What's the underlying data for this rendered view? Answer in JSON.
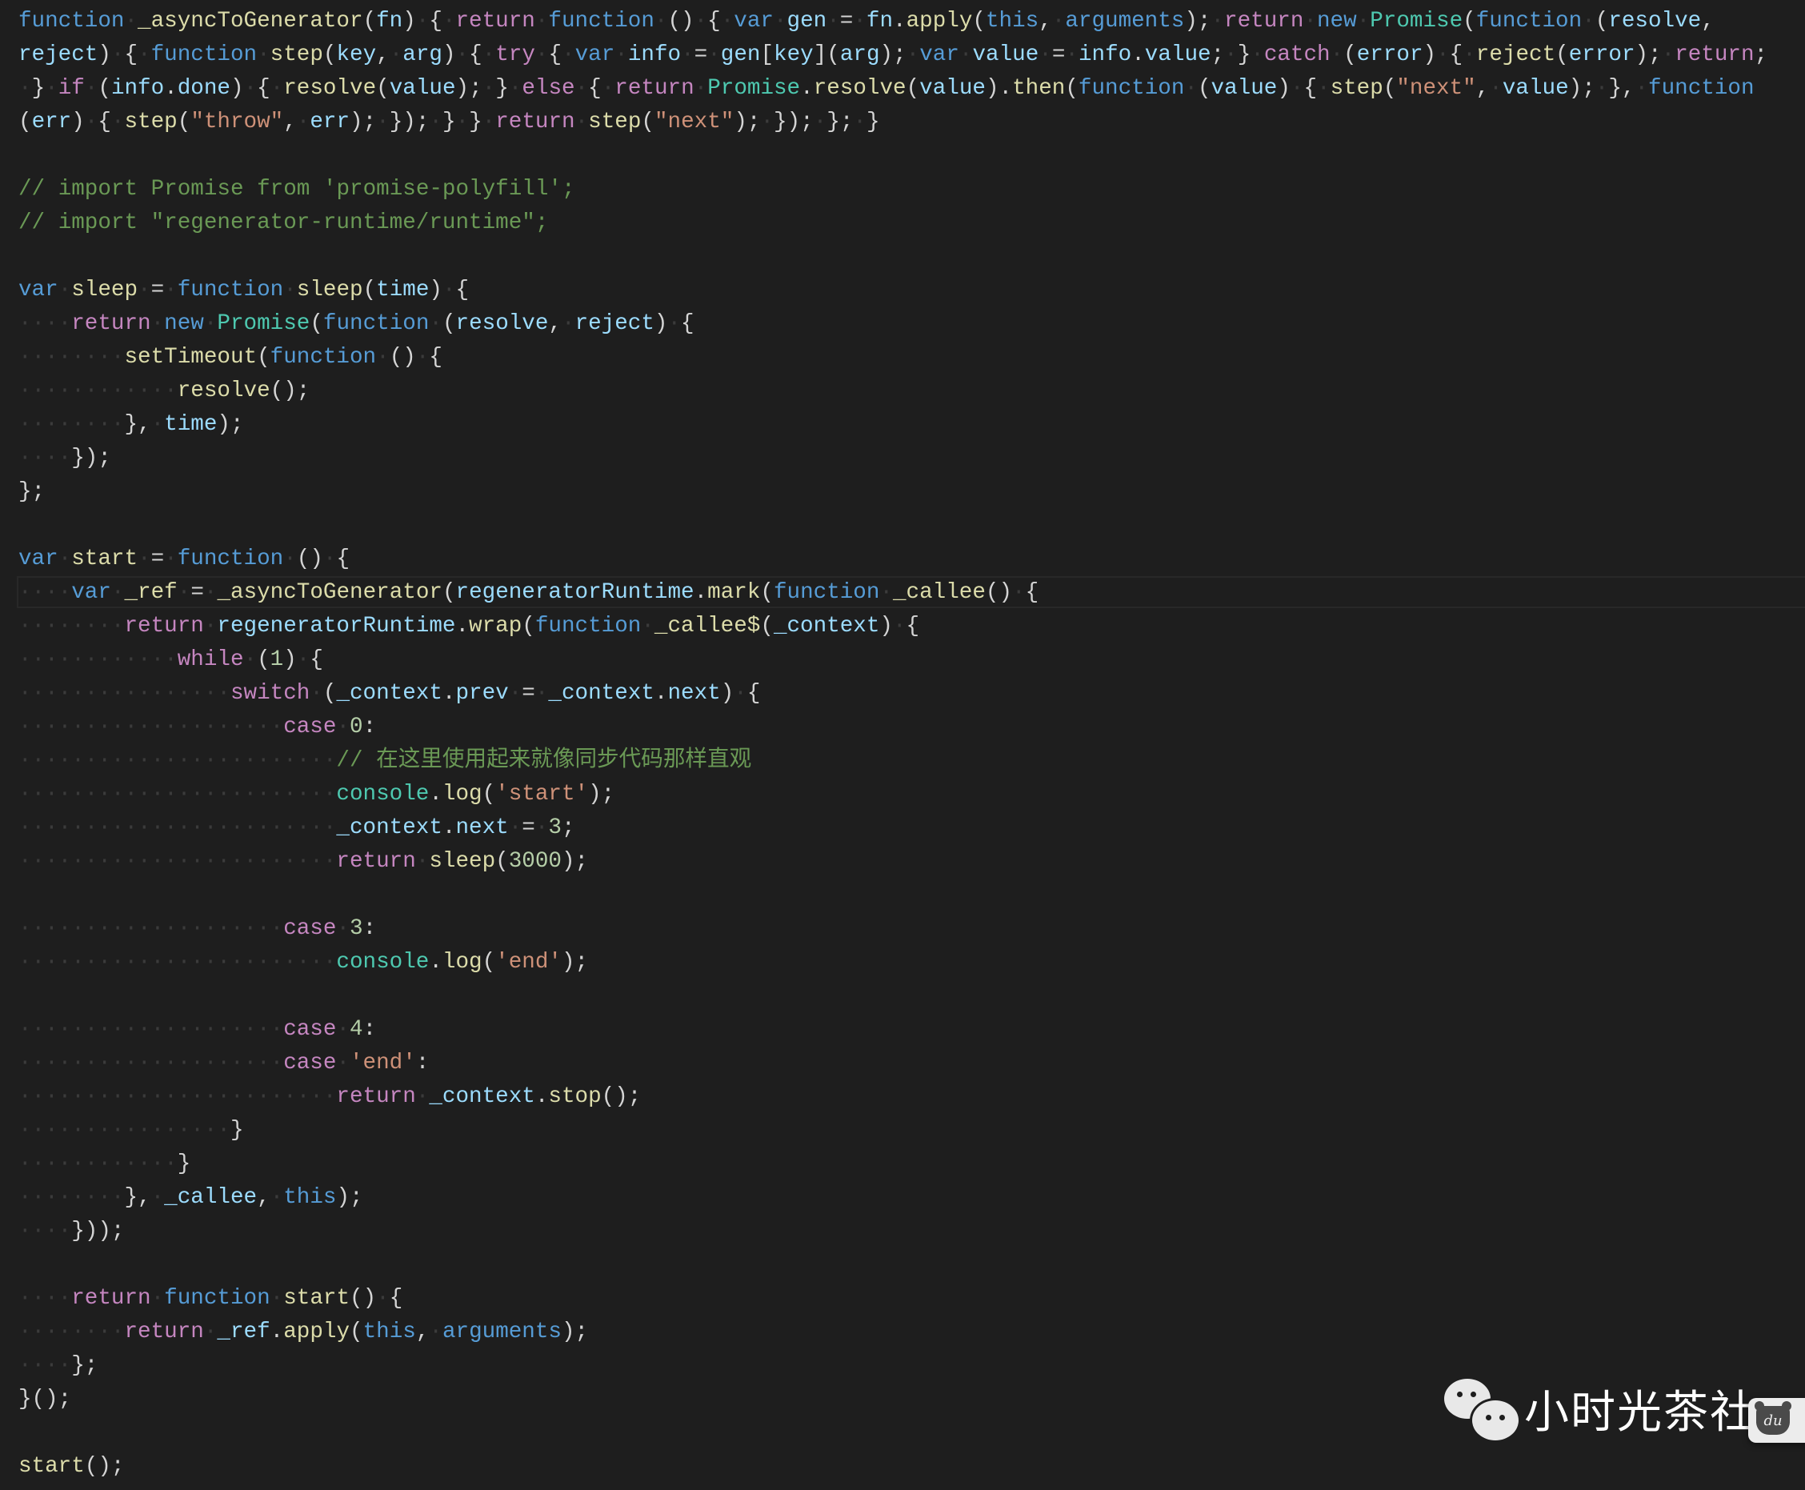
{
  "editor": {
    "theme_colors": {
      "background": "#1e1e1e",
      "keyword": "#569cd6",
      "control": "#c586c0",
      "function": "#dcdcaa",
      "variable": "#9cdcfe",
      "class": "#4ec9b0",
      "string": "#ce9178",
      "number": "#b5cea8",
      "comment": "#6a9955"
    },
    "current_line_index": 17,
    "lines": [
      [
        [
          "kw",
          "function"
        ],
        [
          "pn",
          " "
        ],
        [
          "fn",
          "_asyncToGenerator"
        ],
        [
          "pn",
          "("
        ],
        [
          "var",
          "fn"
        ],
        [
          "pn",
          ") { "
        ],
        [
          "ctl",
          "return"
        ],
        [
          "pn",
          " "
        ],
        [
          "kw",
          "function"
        ],
        [
          "pn",
          " () { "
        ],
        [
          "kw",
          "var"
        ],
        [
          "pn",
          " "
        ],
        [
          "var",
          "gen"
        ],
        [
          "pn",
          " = "
        ],
        [
          "var",
          "fn"
        ],
        [
          "pn",
          "."
        ],
        [
          "fn",
          "apply"
        ],
        [
          "pn",
          "("
        ],
        [
          "kw",
          "this"
        ],
        [
          "pn",
          ", "
        ],
        [
          "kw",
          "arguments"
        ],
        [
          "pn",
          "); "
        ],
        [
          "ctl",
          "return"
        ],
        [
          "pn",
          " "
        ],
        [
          "kw",
          "new"
        ],
        [
          "pn",
          " "
        ],
        [
          "cls",
          "Promise"
        ],
        [
          "pn",
          "("
        ],
        [
          "kw",
          "function"
        ],
        [
          "pn",
          " ("
        ],
        [
          "var",
          "resolve"
        ],
        [
          "pn",
          ","
        ]
      ],
      [
        [
          "var",
          "reject"
        ],
        [
          "pn",
          ") { "
        ],
        [
          "kw",
          "function"
        ],
        [
          "pn",
          " "
        ],
        [
          "fn",
          "step"
        ],
        [
          "pn",
          "("
        ],
        [
          "var",
          "key"
        ],
        [
          "pn",
          ", "
        ],
        [
          "var",
          "arg"
        ],
        [
          "pn",
          ") { "
        ],
        [
          "ctl",
          "try"
        ],
        [
          "pn",
          " { "
        ],
        [
          "kw",
          "var"
        ],
        [
          "pn",
          " "
        ],
        [
          "var",
          "info"
        ],
        [
          "pn",
          " = "
        ],
        [
          "var",
          "gen"
        ],
        [
          "pn",
          "["
        ],
        [
          "var",
          "key"
        ],
        [
          "pn",
          "]("
        ],
        [
          "var",
          "arg"
        ],
        [
          "pn",
          "); "
        ],
        [
          "kw",
          "var"
        ],
        [
          "pn",
          " "
        ],
        [
          "var",
          "value"
        ],
        [
          "pn",
          " = "
        ],
        [
          "var",
          "info"
        ],
        [
          "pn",
          "."
        ],
        [
          "var",
          "value"
        ],
        [
          "pn",
          "; } "
        ],
        [
          "ctl",
          "catch"
        ],
        [
          "pn",
          " ("
        ],
        [
          "var",
          "error"
        ],
        [
          "pn",
          ") { "
        ],
        [
          "fn",
          "reject"
        ],
        [
          "pn",
          "("
        ],
        [
          "var",
          "error"
        ],
        [
          "pn",
          "); "
        ],
        [
          "ctl",
          "return"
        ],
        [
          "pn",
          ";"
        ]
      ],
      [
        [
          "pn",
          " } "
        ],
        [
          "ctl",
          "if"
        ],
        [
          "pn",
          " ("
        ],
        [
          "var",
          "info"
        ],
        [
          "pn",
          "."
        ],
        [
          "var",
          "done"
        ],
        [
          "pn",
          ") { "
        ],
        [
          "fn",
          "resolve"
        ],
        [
          "pn",
          "("
        ],
        [
          "var",
          "value"
        ],
        [
          "pn",
          "); } "
        ],
        [
          "ctl",
          "else"
        ],
        [
          "pn",
          " { "
        ],
        [
          "ctl",
          "return"
        ],
        [
          "pn",
          " "
        ],
        [
          "cls",
          "Promise"
        ],
        [
          "pn",
          "."
        ],
        [
          "fn",
          "resolve"
        ],
        [
          "pn",
          "("
        ],
        [
          "var",
          "value"
        ],
        [
          "pn",
          ")."
        ],
        [
          "fn",
          "then"
        ],
        [
          "pn",
          "("
        ],
        [
          "kw",
          "function"
        ],
        [
          "pn",
          " ("
        ],
        [
          "var",
          "value"
        ],
        [
          "pn",
          ") { "
        ],
        [
          "fn",
          "step"
        ],
        [
          "pn",
          "("
        ],
        [
          "str",
          "\"next\""
        ],
        [
          "pn",
          ", "
        ],
        [
          "var",
          "value"
        ],
        [
          "pn",
          "); }, "
        ],
        [
          "kw",
          "function"
        ]
      ],
      [
        [
          "pn",
          "("
        ],
        [
          "var",
          "err"
        ],
        [
          "pn",
          ") { "
        ],
        [
          "fn",
          "step"
        ],
        [
          "pn",
          "("
        ],
        [
          "str",
          "\"throw\""
        ],
        [
          "pn",
          ", "
        ],
        [
          "var",
          "err"
        ],
        [
          "pn",
          "); }); } } "
        ],
        [
          "ctl",
          "return"
        ],
        [
          "pn",
          " "
        ],
        [
          "fn",
          "step"
        ],
        [
          "pn",
          "("
        ],
        [
          "str",
          "\"next\""
        ],
        [
          "pn",
          "); }); }; }"
        ]
      ],
      [],
      [
        [
          "cm",
          "// import Promise from 'promise-polyfill';"
        ]
      ],
      [
        [
          "cm",
          "// import \"regenerator-runtime/runtime\";"
        ]
      ],
      [],
      [
        [
          "kw",
          "var"
        ],
        [
          "pn",
          " "
        ],
        [
          "fn",
          "sleep"
        ],
        [
          "pn",
          " = "
        ],
        [
          "kw",
          "function"
        ],
        [
          "pn",
          " "
        ],
        [
          "fn",
          "sleep"
        ],
        [
          "pn",
          "("
        ],
        [
          "var",
          "time"
        ],
        [
          "pn",
          ") {"
        ]
      ],
      [
        [
          "pn",
          "    "
        ],
        [
          "ctl",
          "return"
        ],
        [
          "pn",
          " "
        ],
        [
          "kw",
          "new"
        ],
        [
          "pn",
          " "
        ],
        [
          "cls",
          "Promise"
        ],
        [
          "pn",
          "("
        ],
        [
          "kw",
          "function"
        ],
        [
          "pn",
          " ("
        ],
        [
          "var",
          "resolve"
        ],
        [
          "pn",
          ", "
        ],
        [
          "var",
          "reject"
        ],
        [
          "pn",
          ") {"
        ]
      ],
      [
        [
          "pn",
          "        "
        ],
        [
          "fn",
          "setTimeout"
        ],
        [
          "pn",
          "("
        ],
        [
          "kw",
          "function"
        ],
        [
          "pn",
          " () {"
        ]
      ],
      [
        [
          "pn",
          "            "
        ],
        [
          "fn",
          "resolve"
        ],
        [
          "pn",
          "();"
        ]
      ],
      [
        [
          "pn",
          "        }, "
        ],
        [
          "var",
          "time"
        ],
        [
          "pn",
          ");"
        ]
      ],
      [
        [
          "pn",
          "    });"
        ]
      ],
      [
        [
          "pn",
          "};"
        ]
      ],
      [],
      [
        [
          "kw",
          "var"
        ],
        [
          "pn",
          " "
        ],
        [
          "fn",
          "start"
        ],
        [
          "pn",
          " = "
        ],
        [
          "kw",
          "function"
        ],
        [
          "pn",
          " () {"
        ]
      ],
      [
        [
          "pn",
          "    "
        ],
        [
          "kw",
          "var"
        ],
        [
          "pn",
          " "
        ],
        [
          "fn",
          "_ref"
        ],
        [
          "pn",
          " = "
        ],
        [
          "fn",
          "_asyncToGenerator"
        ],
        [
          "pn",
          "("
        ],
        [
          "var",
          "regeneratorRuntime"
        ],
        [
          "pn",
          "."
        ],
        [
          "fn",
          "mark"
        ],
        [
          "pn",
          "("
        ],
        [
          "kw",
          "function"
        ],
        [
          "pn",
          " "
        ],
        [
          "fn",
          "_callee"
        ],
        [
          "pn",
          "() {"
        ]
      ],
      [
        [
          "pn",
          "        "
        ],
        [
          "ctl",
          "return"
        ],
        [
          "pn",
          " "
        ],
        [
          "var",
          "regeneratorRuntime"
        ],
        [
          "pn",
          "."
        ],
        [
          "fn",
          "wrap"
        ],
        [
          "pn",
          "("
        ],
        [
          "kw",
          "function"
        ],
        [
          "pn",
          " "
        ],
        [
          "fn",
          "_callee$"
        ],
        [
          "pn",
          "("
        ],
        [
          "var",
          "_context"
        ],
        [
          "pn",
          ") {"
        ]
      ],
      [
        [
          "pn",
          "            "
        ],
        [
          "ctl",
          "while"
        ],
        [
          "pn",
          " ("
        ],
        [
          "num",
          "1"
        ],
        [
          "pn",
          ") {"
        ]
      ],
      [
        [
          "pn",
          "                "
        ],
        [
          "ctl",
          "switch"
        ],
        [
          "pn",
          " ("
        ],
        [
          "var",
          "_context"
        ],
        [
          "pn",
          "."
        ],
        [
          "var",
          "prev"
        ],
        [
          "pn",
          " = "
        ],
        [
          "var",
          "_context"
        ],
        [
          "pn",
          "."
        ],
        [
          "var",
          "next"
        ],
        [
          "pn",
          ") {"
        ]
      ],
      [
        [
          "pn",
          "                    "
        ],
        [
          "ctl",
          "case"
        ],
        [
          "pn",
          " "
        ],
        [
          "num",
          "0"
        ],
        [
          "pn",
          ":"
        ]
      ],
      [
        [
          "pn",
          "                        "
        ],
        [
          "cm",
          "// 在这里使用起来就像同步代码那样直观"
        ]
      ],
      [
        [
          "pn",
          "                        "
        ],
        [
          "cls",
          "console"
        ],
        [
          "pn",
          "."
        ],
        [
          "fn",
          "log"
        ],
        [
          "pn",
          "("
        ],
        [
          "str",
          "'start'"
        ],
        [
          "pn",
          ");"
        ]
      ],
      [
        [
          "pn",
          "                        "
        ],
        [
          "var",
          "_context"
        ],
        [
          "pn",
          "."
        ],
        [
          "var",
          "next"
        ],
        [
          "pn",
          " = "
        ],
        [
          "num",
          "3"
        ],
        [
          "pn",
          ";"
        ]
      ],
      [
        [
          "pn",
          "                        "
        ],
        [
          "ctl",
          "return"
        ],
        [
          "pn",
          " "
        ],
        [
          "fn",
          "sleep"
        ],
        [
          "pn",
          "("
        ],
        [
          "num",
          "3000"
        ],
        [
          "pn",
          ");"
        ]
      ],
      [],
      [
        [
          "pn",
          "                    "
        ],
        [
          "ctl",
          "case"
        ],
        [
          "pn",
          " "
        ],
        [
          "num",
          "3"
        ],
        [
          "pn",
          ":"
        ]
      ],
      [
        [
          "pn",
          "                        "
        ],
        [
          "cls",
          "console"
        ],
        [
          "pn",
          "."
        ],
        [
          "fn",
          "log"
        ],
        [
          "pn",
          "("
        ],
        [
          "str",
          "'end'"
        ],
        [
          "pn",
          ");"
        ]
      ],
      [],
      [
        [
          "pn",
          "                    "
        ],
        [
          "ctl",
          "case"
        ],
        [
          "pn",
          " "
        ],
        [
          "num",
          "4"
        ],
        [
          "pn",
          ":"
        ]
      ],
      [
        [
          "pn",
          "                    "
        ],
        [
          "ctl",
          "case"
        ],
        [
          "pn",
          " "
        ],
        [
          "str",
          "'end'"
        ],
        [
          "pn",
          ":"
        ]
      ],
      [
        [
          "pn",
          "                        "
        ],
        [
          "ctl",
          "return"
        ],
        [
          "pn",
          " "
        ],
        [
          "var",
          "_context"
        ],
        [
          "pn",
          "."
        ],
        [
          "fn",
          "stop"
        ],
        [
          "pn",
          "();"
        ]
      ],
      [
        [
          "pn",
          "                }"
        ]
      ],
      [
        [
          "pn",
          "            }"
        ]
      ],
      [
        [
          "pn",
          "        }, "
        ],
        [
          "var",
          "_callee"
        ],
        [
          "pn",
          ", "
        ],
        [
          "kw",
          "this"
        ],
        [
          "pn",
          ");"
        ]
      ],
      [
        [
          "pn",
          "    }));"
        ]
      ],
      [],
      [
        [
          "pn",
          "    "
        ],
        [
          "ctl",
          "return"
        ],
        [
          "pn",
          " "
        ],
        [
          "kw",
          "function"
        ],
        [
          "pn",
          " "
        ],
        [
          "fn",
          "start"
        ],
        [
          "pn",
          "() {"
        ]
      ],
      [
        [
          "pn",
          "        "
        ],
        [
          "ctl",
          "return"
        ],
        [
          "pn",
          " "
        ],
        [
          "var",
          "_ref"
        ],
        [
          "pn",
          "."
        ],
        [
          "fn",
          "apply"
        ],
        [
          "pn",
          "("
        ],
        [
          "kw",
          "this"
        ],
        [
          "pn",
          ", "
        ],
        [
          "kw",
          "arguments"
        ],
        [
          "pn",
          ");"
        ]
      ],
      [
        [
          "pn",
          "    };"
        ]
      ],
      [
        [
          "pn",
          "}();"
        ]
      ],
      [],
      [
        [
          "fn",
          "start"
        ],
        [
          "pn",
          "();"
        ]
      ]
    ]
  },
  "watermark": {
    "icon": "wechat-icon",
    "text": "小时光茶社"
  },
  "badge": {
    "icon": "baidu-du-icon",
    "text": "du"
  }
}
